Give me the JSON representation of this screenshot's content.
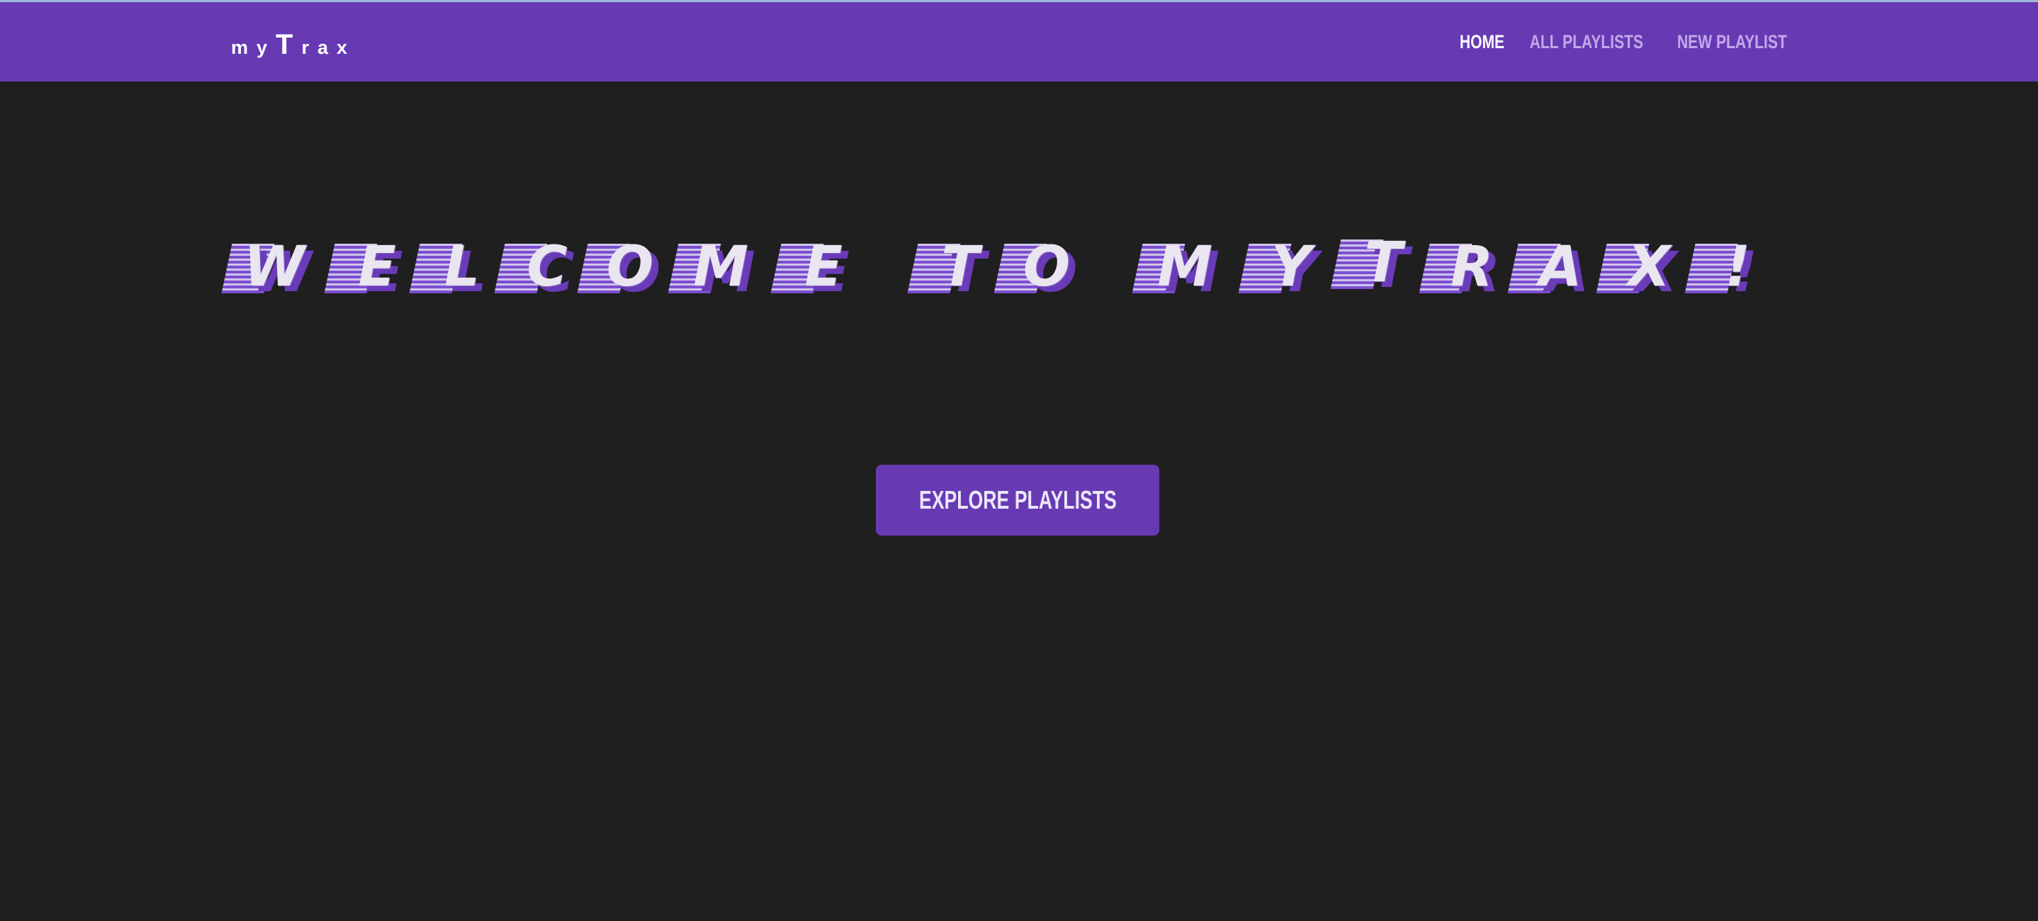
{
  "app": {
    "brand": "myTrax",
    "brand_parts": [
      "m",
      "y",
      "T",
      "r",
      "a",
      "x"
    ]
  },
  "nav": {
    "links": [
      {
        "label": "HOME",
        "active": true
      },
      {
        "label": "ALL PLAYLISTS",
        "active": false
      },
      {
        "label": "NEW PLAYLIST",
        "active": false
      }
    ]
  },
  "hero": {
    "heading": "Welcome to myTrax!",
    "letters": [
      "W",
      "E",
      "L",
      "C",
      "O",
      "M",
      "E",
      "T",
      "O",
      "M",
      "Y",
      "T",
      "R",
      "A",
      "X",
      "!"
    ]
  },
  "cta": {
    "label": "EXPLORE PLAYLISTS"
  },
  "colors": {
    "accent": "#673ab4",
    "background": "#1f1f1f",
    "nav_active": "#ffffff",
    "nav_inactive": "#c2a8ea",
    "hero_text": "#e9e6f0"
  }
}
